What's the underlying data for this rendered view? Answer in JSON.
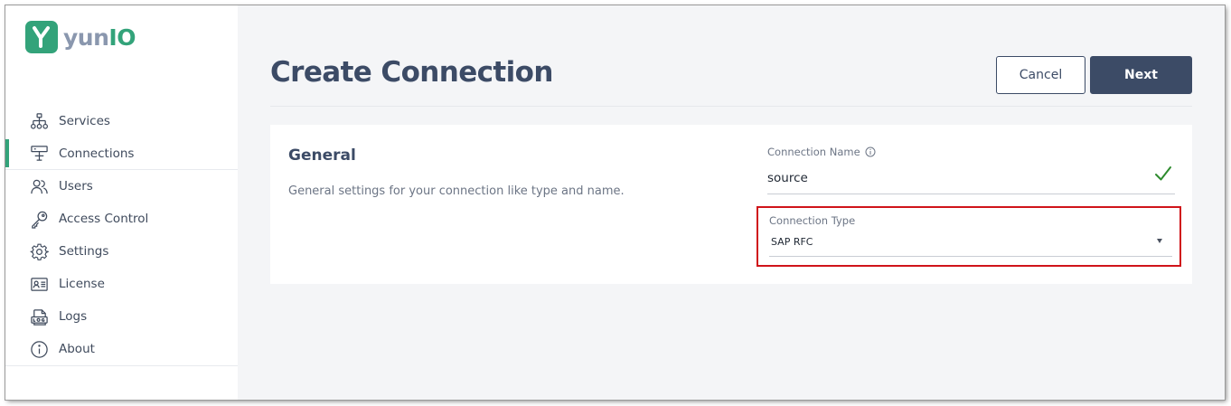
{
  "app": {
    "logo_text_main": "yun",
    "logo_text_accent": "IO"
  },
  "sidebar": {
    "items": [
      {
        "label": "Services",
        "icon": "sitemap-icon"
      },
      {
        "label": "Connections",
        "icon": "connections-icon"
      },
      {
        "label": "Users",
        "icon": "users-icon"
      },
      {
        "label": "Access Control",
        "icon": "key-icon"
      },
      {
        "label": "Settings",
        "icon": "gear-icon"
      },
      {
        "label": "License",
        "icon": "id-card-icon"
      },
      {
        "label": "Logs",
        "icon": "logs-icon"
      },
      {
        "label": "About",
        "icon": "info-icon"
      }
    ],
    "active": "Connections"
  },
  "header": {
    "title": "Create Connection",
    "cancel_label": "Cancel",
    "next_label": "Next"
  },
  "general": {
    "title": "General",
    "description": "General settings for your connection like type and name."
  },
  "form": {
    "connection_name_label": "Connection Name",
    "connection_name_value": "source",
    "connection_type_label": "Connection Type",
    "connection_type_value": "SAP RFC"
  },
  "colors": {
    "brand_green": "#33a37a",
    "navy": "#3c4b66",
    "highlight_red": "#d0141a"
  }
}
